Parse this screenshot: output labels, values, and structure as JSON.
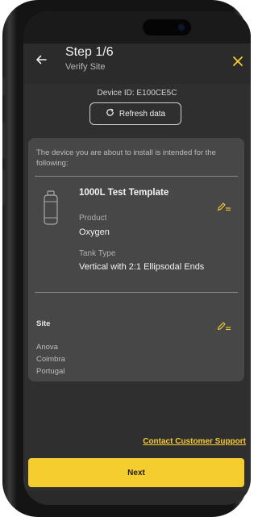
{
  "header": {
    "step": "Step 1/6",
    "subtitle": "Verify Site"
  },
  "device": {
    "id_text": "Device ID: E100CE5C",
    "refresh_label": "Refresh data"
  },
  "card": {
    "intro": "The device you are about to install is intended for the following:",
    "template_name": "1000L Test Template",
    "product_label": "Product",
    "product_value": "Oxygen",
    "tank_type_label": "Tank Type",
    "tank_type_value": "Vertical with 2:1 Ellipsodal Ends",
    "site_label": "Site",
    "site_lines": [
      "Anova",
      "Coimbra",
      "Portugal"
    ]
  },
  "footer": {
    "support_label": "Contact Customer Support",
    "next_label": "Next"
  },
  "colors": {
    "accent": "#f5cd2e",
    "background": "#2f2f2f",
    "card": "#474747"
  },
  "icons": [
    "back-arrow-icon",
    "close-icon",
    "refresh-icon",
    "tank-icon",
    "edit-icon"
  ]
}
